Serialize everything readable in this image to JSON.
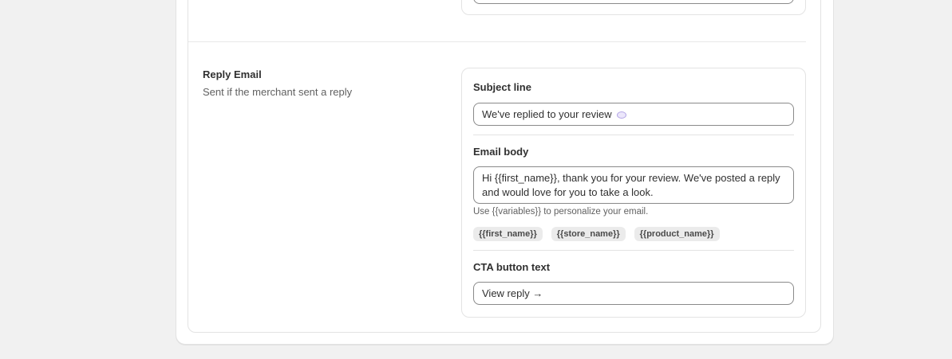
{
  "section": {
    "title": "Reply Email",
    "description": "Sent if the merchant sent a reply"
  },
  "subject": {
    "label": "Subject line",
    "value": "We've replied to your review",
    "icon": "speech-bubble-icon"
  },
  "body": {
    "label": "Email body",
    "value": "Hi {{first_name}}, thank you for your review. We've posted a reply and would love for you to take a look.",
    "help": "Use {{variables}} to personalize your email.",
    "variables": [
      "{{first_name}}",
      "{{store_name}}",
      "{{product_name}}"
    ]
  },
  "cta": {
    "label": "CTA button text",
    "value": "View reply →"
  }
}
